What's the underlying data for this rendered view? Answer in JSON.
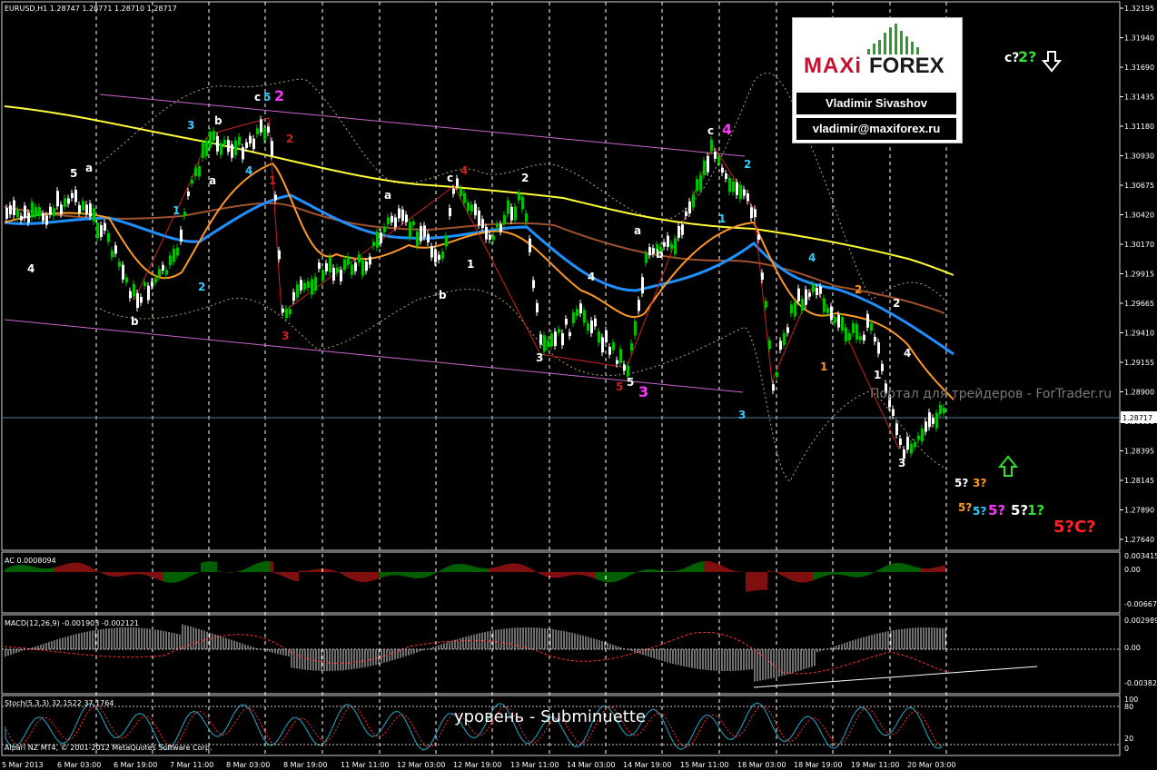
{
  "header": {
    "symbol": "EURUSD,H1",
    "ohlc": "1.28747 1.28771 1.28710 1.28717"
  },
  "price_axis": {
    "ticks": [
      "1.32195",
      "1.31940",
      "1.31690",
      "1.31435",
      "1.31180",
      "1.30930",
      "1.30675",
      "1.30420",
      "1.30170",
      "1.29915",
      "1.29665",
      "1.29410",
      "1.29155",
      "1.28900",
      "1.28650",
      "1.28395",
      "1.28145",
      "1.27890",
      "1.27640"
    ],
    "current_price": "1.28717"
  },
  "time_axis": [
    "5 Mar 2013",
    "6 Mar 03:00",
    "6 Mar 19:00",
    "7 Mar 11:00",
    "8 Mar 03:00",
    "8 Mar 19:00",
    "11 Mar 11:00",
    "12 Mar 03:00",
    "12 Mar 19:00",
    "13 Mar 11:00",
    "14 Mar 03:00",
    "14 Mar 19:00",
    "15 Mar 11:00",
    "18 Mar 03:00",
    "18 Mar 19:00",
    "19 Mar 11:00",
    "20 Mar 03:00"
  ],
  "indicators": {
    "ac": {
      "label": "AC 0.0008094",
      "ticks": [
        "0.003415",
        "0.00",
        "-0.006671"
      ]
    },
    "macd": {
      "label": "MACD(12,26,9) -0.001903 -0.002121",
      "ticks": [
        "0.002989",
        "0.00",
        "-0.003821"
      ]
    },
    "stoch": {
      "label": "Stoch(5,3,3) 32.1522 37.1764",
      "ticks": [
        "100",
        "80",
        "20",
        "0"
      ]
    }
  },
  "copyright": "Alpari NZ MT4, © 2001-2012 MetaQuotes Software Corp.",
  "logo": {
    "brand_a": "MAXi",
    "brand_b": "FOREX",
    "author": "Vladimir Sivashov",
    "email": "vladimir@maxiforex.ru"
  },
  "watermark": "Портал для трейдеров - ForTrader.ru",
  "level_caption": "уровень - Subminuette",
  "colors": {
    "up_candle": "#00c000",
    "down_candle": "#ffffff",
    "ema_yellow": "#ffff33",
    "ema_brown": "#a0522d",
    "ema_blue": "#1e90ff",
    "ema_orange": "#ff9922",
    "channel": "#cc66cc",
    "wave_red": "#cc2222",
    "grid": "#ffffff"
  },
  "wave_labels": [
    {
      "t": "4",
      "c": "#ffffff"
    },
    {
      "t": "5",
      "c": "#ffffff"
    },
    {
      "t": "a",
      "c": "#ffffff"
    },
    {
      "t": "b",
      "c": "#ffffff"
    },
    {
      "t": "1",
      "c": "#33ccff"
    },
    {
      "t": "2",
      "c": "#33ccff"
    },
    {
      "t": "3",
      "c": "#33ccff"
    },
    {
      "t": "b",
      "c": "#ffffff"
    },
    {
      "t": "4",
      "c": "#33ccff"
    },
    {
      "t": "a",
      "c": "#ffffff"
    },
    {
      "t": "c",
      "c": "#ffffff"
    },
    {
      "t": "5",
      "c": "#33ccff"
    },
    {
      "t": "2",
      "c": "#ff33ff"
    },
    {
      "t": "2",
      "c": "#cc2222"
    },
    {
      "t": "1",
      "c": "#cc2222"
    },
    {
      "t": "3",
      "c": "#cc2222"
    },
    {
      "t": "a",
      "c": "#ffffff"
    },
    {
      "t": "c",
      "c": "#ffffff"
    },
    {
      "t": "4",
      "c": "#cc2222"
    },
    {
      "t": "b",
      "c": "#ffffff"
    },
    {
      "t": "1",
      "c": "#ffffff"
    },
    {
      "t": "2",
      "c": "#ffffff"
    },
    {
      "t": "3",
      "c": "#ffffff"
    },
    {
      "t": "4",
      "c": "#ffffff"
    },
    {
      "t": "5",
      "c": "#cc2222"
    },
    {
      "t": "5",
      "c": "#ffffff"
    },
    {
      "t": "3",
      "c": "#ff33ff"
    },
    {
      "t": "a",
      "c": "#ffffff"
    },
    {
      "t": "b",
      "c": "#ffffff"
    },
    {
      "t": "c",
      "c": "#ffffff"
    },
    {
      "t": "4",
      "c": "#ff33ff"
    },
    {
      "t": "1",
      "c": "#33ccff"
    },
    {
      "t": "2",
      "c": "#33ccff"
    },
    {
      "t": "3",
      "c": "#33ccff"
    },
    {
      "t": "4",
      "c": "#33ccff"
    },
    {
      "t": "1",
      "c": "#ff9922"
    },
    {
      "t": "2",
      "c": "#ff9922"
    },
    {
      "t": "2",
      "c": "#ffffff"
    },
    {
      "t": "1",
      "c": "#ffffff"
    },
    {
      "t": "4",
      "c": "#ffffff"
    },
    {
      "t": "3",
      "c": "#ffffff"
    }
  ],
  "forecast_labels": [
    {
      "t": "c?",
      "c": "#ffffff"
    },
    {
      "t": "2?",
      "c": "#33dd33"
    },
    {
      "t": "5?",
      "c": "#ffffff"
    },
    {
      "t": "3?",
      "c": "#ff9922"
    },
    {
      "t": "5?",
      "c": "#ff9922"
    },
    {
      "t": "5?",
      "c": "#33ccff"
    },
    {
      "t": "5?",
      "c": "#ff33ff"
    },
    {
      "t": "5?",
      "c": "#ffffff"
    },
    {
      "t": "1?",
      "c": "#33dd33"
    },
    {
      "t": "5?C?",
      "c": "#ff2222"
    }
  ]
}
